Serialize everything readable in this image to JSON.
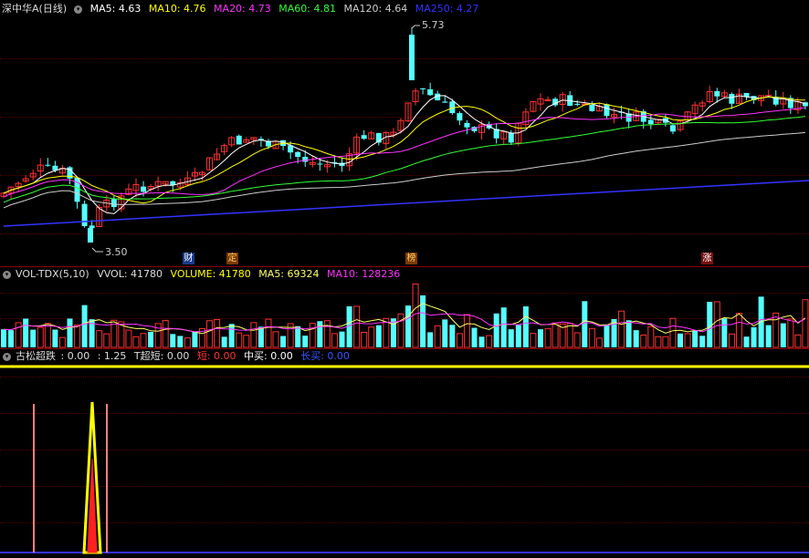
{
  "main": {
    "title": "深中华A(日线)",
    "ma": [
      {
        "label": "MA5: 4.63",
        "color": "#ffffff"
      },
      {
        "label": "MA10: 4.76",
        "color": "#ffff00"
      },
      {
        "label": "MA20: 4.73",
        "color": "#ff33ff"
      },
      {
        "label": "MA60: 4.81",
        "color": "#33ff33"
      },
      {
        "label": "MA120: 4.64",
        "color": "#cccccc"
      },
      {
        "label": "MA250: 4.27",
        "color": "#3333ff"
      }
    ],
    "high_label": "5.73",
    "low_label": "3.50",
    "events": [
      {
        "text": "财",
        "bg": "#1a3a8a",
        "fg": "#ffffff"
      },
      {
        "text": "定",
        "bg": "#7a3a00",
        "fg": "#ffcc66"
      },
      {
        "text": "榜",
        "bg": "#7a3a00",
        "fg": "#ffcc66"
      },
      {
        "text": "涨",
        "bg": "#7a1010",
        "fg": "#ffffff"
      }
    ]
  },
  "volume": {
    "title": "VOL-TDX(5,10)",
    "items": [
      {
        "label": "VVOL: 41780",
        "color": "#dddddd"
      },
      {
        "label": "VOLUME: 41780",
        "color": "#ffff00"
      },
      {
        "label": "MA5: 69324",
        "color": "#ffff66"
      },
      {
        "label": "MA10: 128236",
        "color": "#ff33ff"
      }
    ]
  },
  "indicator": {
    "title": "古松超跌",
    "items": [
      {
        "label": ": 0.00",
        "color": "#dddddd"
      },
      {
        "label": ": 1.25",
        "color": "#dddddd"
      },
      {
        "label": "T超短: 0.00",
        "color": "#dddddd"
      },
      {
        "label": "短: 0.00",
        "color": "#ff3333"
      },
      {
        "label": "中买: 0.00",
        "color": "#ffffff"
      },
      {
        "label": "长买: 0.00",
        "color": "#3355ff"
      }
    ]
  },
  "colors": {
    "up": "#ff3232",
    "down": "#54ffff",
    "grid": "#5a0000",
    "sep": "#8a0000"
  }
}
